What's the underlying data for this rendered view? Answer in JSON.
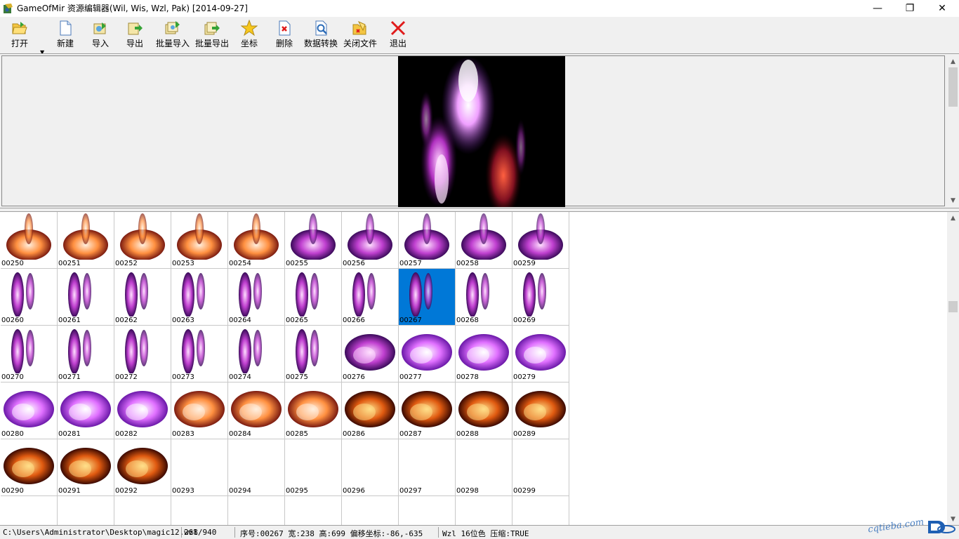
{
  "window": {
    "title": "GameOfMir 资源编辑器(Wil, Wis, Wzl, Pak) [2014-09-27]",
    "minimize_glyph": "—",
    "restore_glyph": "❐",
    "close_glyph": "✕"
  },
  "toolbar": {
    "buttons": [
      {
        "label": "打开",
        "icon": "open-folder-icon"
      },
      {
        "label": "新建",
        "icon": "new-file-icon"
      },
      {
        "label": "导入",
        "icon": "import-icon"
      },
      {
        "label": "导出",
        "icon": "export-icon"
      },
      {
        "label": "批量导入",
        "icon": "batch-import-icon"
      },
      {
        "label": "批量导出",
        "icon": "batch-export-icon"
      },
      {
        "label": "坐标",
        "icon": "star-icon"
      },
      {
        "label": "删除",
        "icon": "delete-icon"
      },
      {
        "label": "数据转换",
        "icon": "convert-icon"
      },
      {
        "label": "关闭文件",
        "icon": "close-file-icon"
      },
      {
        "label": "退出",
        "icon": "exit-x-icon"
      }
    ]
  },
  "grid": {
    "selected": "00267",
    "cells": [
      "00250",
      "00251",
      "00252",
      "00253",
      "00254",
      "00255",
      "00256",
      "00257",
      "00258",
      "00259",
      "00260",
      "00261",
      "00262",
      "00263",
      "00264",
      "00265",
      "00266",
      "00267",
      "00268",
      "00269",
      "00270",
      "00271",
      "00272",
      "00273",
      "00274",
      "00275",
      "00276",
      "00277",
      "00278",
      "00279",
      "00280",
      "00281",
      "00282",
      "00283",
      "00284",
      "00285",
      "00286",
      "00287",
      "00288",
      "00289",
      "00290",
      "00291",
      "00292",
      "00293",
      "00294",
      "00295",
      "00296",
      "00297",
      "00298",
      "00299"
    ],
    "empty_from": "00293"
  },
  "status": {
    "path": "C:\\Users\\Administrator\\Desktop\\magic12.wzl",
    "count": "268/940",
    "info": "序号:00267 宽:238 高:699 偏移坐标:-86,-635",
    "format": "Wzl 16位色 压缩:TRUE"
  },
  "watermark": {
    "text": "cqtieba.com"
  },
  "colors": {
    "selection": "#0078d7",
    "preview_bg": "#000000",
    "close_red": "#e81123"
  }
}
